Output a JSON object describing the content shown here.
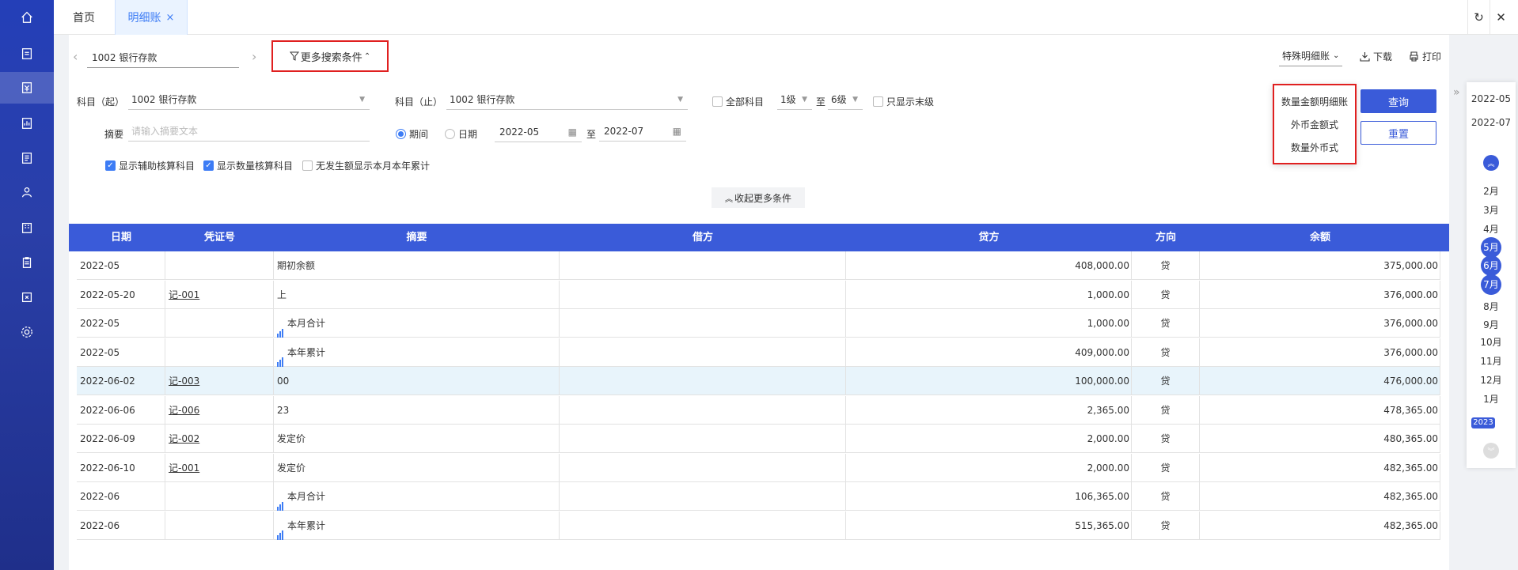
{
  "tabs": {
    "home": "首页",
    "active": "明细账",
    "close": "×"
  },
  "toolbar": {
    "refresh_icon": "↻",
    "close_icon": "✕"
  },
  "subject_nav": {
    "value": "1002 银行存款"
  },
  "more_search": {
    "label": "更多搜索条件"
  },
  "actions": {
    "special_ledger": "特殊明细账",
    "download": "下载",
    "print": "打印"
  },
  "dropdown": {
    "items": [
      "数量金额明细账",
      "外币金额式",
      "数量外币式"
    ]
  },
  "filters": {
    "subject_from_label": "科目（起）",
    "subject_from_value": "1002 银行存款",
    "subject_to_label": "科目（止）",
    "subject_to_value": "1002 银行存款",
    "all_subjects": "全部科目",
    "level_from": "1级",
    "to": "至",
    "level_to": "6级",
    "only_last_level": "只显示末级",
    "summary_label": "摘要",
    "summary_placeholder": "请输入摘要文本",
    "period": "期间",
    "date": "日期",
    "period_from": "2022-05",
    "period_to": "2022-07",
    "show_aux": "显示辅助核算科目",
    "show_qty": "显示数量核算科目",
    "no_amount_show": "无发生额显示本月本年累计",
    "query": "查询",
    "reset": "重置",
    "collapse": "收起更多条件"
  },
  "table": {
    "headers": [
      "日期",
      "凭证号",
      "摘要",
      "借方",
      "贷方",
      "方向",
      "余额"
    ],
    "rows": [
      {
        "date": "2022-05",
        "voucher": "",
        "summary": "期初余额",
        "sum": false,
        "debit": "",
        "credit": "408,000.00",
        "dir": "贷",
        "balance": "375,000.00"
      },
      {
        "date": "2022-05-20",
        "voucher": "记-001",
        "summary": "上",
        "sum": false,
        "debit": "",
        "credit": "1,000.00",
        "dir": "贷",
        "balance": "376,000.00"
      },
      {
        "date": "2022-05",
        "voucher": "",
        "summary": "本月合计",
        "sum": true,
        "debit": "",
        "credit": "1,000.00",
        "dir": "贷",
        "balance": "376,000.00"
      },
      {
        "date": "2022-05",
        "voucher": "",
        "summary": "本年累计",
        "sum": true,
        "debit": "",
        "credit": "409,000.00",
        "dir": "贷",
        "balance": "376,000.00"
      },
      {
        "date": "2022-06-02",
        "voucher": "记-003",
        "summary": "00",
        "sum": false,
        "debit": "",
        "credit": "100,000.00",
        "dir": "贷",
        "balance": "476,000.00"
      },
      {
        "date": "2022-06-06",
        "voucher": "记-006",
        "summary": "23",
        "sum": false,
        "debit": "",
        "credit": "2,365.00",
        "dir": "贷",
        "balance": "478,365.00"
      },
      {
        "date": "2022-06-09",
        "voucher": "记-002",
        "summary": "发定价",
        "sum": false,
        "debit": "",
        "credit": "2,000.00",
        "dir": "贷",
        "balance": "480,365.00"
      },
      {
        "date": "2022-06-10",
        "voucher": "记-001",
        "summary": "发定价",
        "sum": false,
        "debit": "",
        "credit": "2,000.00",
        "dir": "贷",
        "balance": "482,365.00"
      },
      {
        "date": "2022-06",
        "voucher": "",
        "summary": "本月合计",
        "sum": true,
        "debit": "",
        "credit": "106,365.00",
        "dir": "贷",
        "balance": "482,365.00"
      },
      {
        "date": "2022-06",
        "voucher": "",
        "summary": "本年累计",
        "sum": true,
        "debit": "",
        "credit": "515,365.00",
        "dir": "贷",
        "balance": "482,365.00"
      }
    ]
  },
  "period_panel": {
    "start": "2022-05",
    "end": "2022-07",
    "months": [
      "2月",
      "3月",
      "4月",
      "5月",
      "6月",
      "7月",
      "8月",
      "9月",
      "10月",
      "11月",
      "12月",
      "1月"
    ],
    "selected": [
      "5月",
      "6月",
      "7月"
    ],
    "year_badge": "2023"
  },
  "colors": {
    "accent": "#3a5bd9",
    "highlight_border": "#e02020",
    "row_highlight": "#e8f4fb"
  }
}
